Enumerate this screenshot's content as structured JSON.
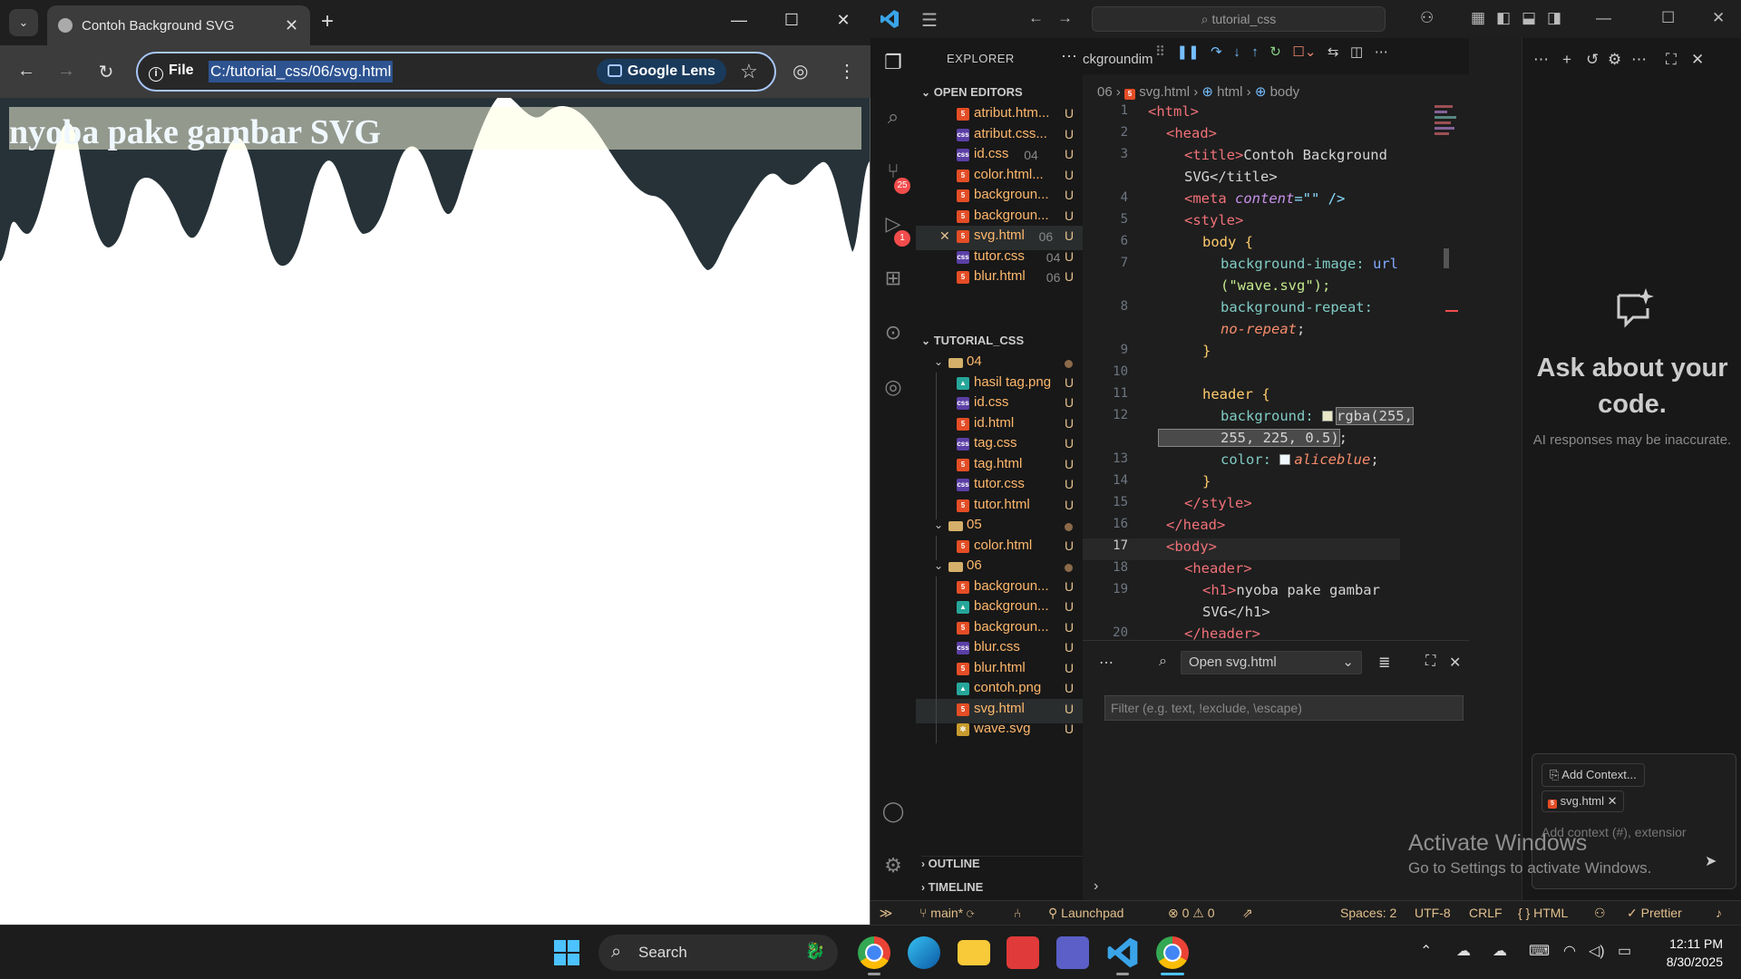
{
  "browser": {
    "tab_title": "Contoh Background SVG",
    "site_label": "File",
    "url": "C:/tutorial_css/06/svg.html",
    "lens_label": "Google Lens",
    "page_heading": "nyoba pake gambar SVG"
  },
  "vscode": {
    "command_center": "tutorial_css",
    "explorer_title": "EXPLORER",
    "open_editors_title": "OPEN EDITORS",
    "open_editors": [
      {
        "name": "atribut.htm...",
        "badge": "U",
        "type": "html",
        "num": ""
      },
      {
        "name": "atribut.css...",
        "badge": "U",
        "type": "css",
        "num": ""
      },
      {
        "name": "id.css",
        "badge": "U",
        "type": "css",
        "num": "04"
      },
      {
        "name": "color.html...",
        "badge": "U",
        "type": "html",
        "num": ""
      },
      {
        "name": "backgroun...",
        "badge": "U",
        "type": "html",
        "num": ""
      },
      {
        "name": "backgroun...",
        "badge": "U",
        "type": "html",
        "num": ""
      },
      {
        "name": "svg.html",
        "badge": "U",
        "type": "html",
        "num": "06"
      },
      {
        "name": "tutor.css",
        "badge": "U",
        "type": "css",
        "num": "04"
      },
      {
        "name": "blur.html",
        "badge": "U",
        "type": "html",
        "num": "06"
      }
    ],
    "workspace_title": "TUTORIAL_CSS",
    "tree": [
      {
        "name": "04",
        "type": "folder",
        "badge": ""
      },
      {
        "name": "hasil tag.png",
        "type": "img",
        "badge": "U"
      },
      {
        "name": "id.css",
        "type": "css",
        "badge": "U"
      },
      {
        "name": "id.html",
        "type": "html",
        "badge": "U"
      },
      {
        "name": "tag.css",
        "type": "css",
        "badge": "U"
      },
      {
        "name": "tag.html",
        "type": "html",
        "badge": "U"
      },
      {
        "name": "tutor.css",
        "type": "css",
        "badge": "U"
      },
      {
        "name": "tutor.html",
        "type": "html",
        "badge": "U"
      },
      {
        "name": "05",
        "type": "folder",
        "badge": ""
      },
      {
        "name": "color.html",
        "type": "html",
        "badge": "U"
      },
      {
        "name": "06",
        "type": "folder",
        "badge": ""
      },
      {
        "name": "backgroun...",
        "type": "html",
        "badge": "U"
      },
      {
        "name": "backgroun...",
        "type": "img",
        "badge": "U"
      },
      {
        "name": "backgroun...",
        "type": "html",
        "badge": "U"
      },
      {
        "name": "blur.css",
        "type": "css",
        "badge": "U"
      },
      {
        "name": "blur.html",
        "type": "html",
        "badge": "U"
      },
      {
        "name": "contoh.png",
        "type": "img",
        "badge": "U"
      },
      {
        "name": "svg.html",
        "type": "html",
        "badge": "U"
      },
      {
        "name": "wave.svg",
        "type": "svg",
        "badge": "U"
      }
    ],
    "outline_title": "OUTLINE",
    "timeline_title": "TIMELINE",
    "editor_tab": "ckgroundim",
    "breadcrumbs": {
      "folder": "06",
      "file": "svg.html",
      "el1": "html",
      "el2": "body"
    },
    "line_numbers": [
      "1",
      "2",
      "3",
      "",
      "4",
      "5",
      "6",
      "7",
      "",
      "8",
      "",
      "9",
      "10",
      "11",
      "12",
      "",
      "13",
      "14",
      "15",
      "16",
      "17",
      "18",
      "19",
      "",
      "20"
    ],
    "code": {
      "l1": "<html>",
      "l2": "<head>",
      "l3a": "<title>",
      "l3b": "Contoh Background",
      "l3c": "SVG</title>",
      "l4a": "<meta ",
      "l4b": "content",
      "l4c": "=\"\" />",
      "l5": "<style>",
      "l6": "body {",
      "l7a": "background-image: ",
      "l7b": "url",
      "l7c": "(\"wave.svg\");",
      "l8a": "background-repeat:",
      "l8b": "no-repeat",
      "l8c": ";",
      "l9": "}",
      "l11": "header {",
      "l12a": "background: ",
      "l12b": "rgba(255,",
      "l12c": "255, 225, 0.5)",
      "l12d": ";",
      "l13a": "color: ",
      "l13b": "aliceblue",
      "l13c": ";",
      "l14": "}",
      "l15": "</style>",
      "l16": "</head>",
      "l17": "<body>",
      "l18": "<header>",
      "l19a": "<h1>",
      "l19b": "nyoba pake gambar",
      "l19c": "SVG</h1>",
      "l20": "</header>"
    },
    "panel_select": "Open svg.html",
    "panel_filter_placeholder": "Filter (e.g. text, !exclude, \\escape)",
    "chat_title": "Ask about your code.",
    "chat_subtitle": "AI responses may be inaccurate.",
    "chat_add_context": "Add Context...",
    "chat_context_file": "svg.html",
    "chat_placeholder": "Add context (#), extensior",
    "activity_badges": {
      "scm": "25",
      "debug": "1"
    },
    "statusbar": {
      "branch": "main*",
      "launchpad": "Launchpad",
      "errors": "0",
      "warnings": "0",
      "spaces": "Spaces: 2",
      "encoding": "UTF-8",
      "eol": "CRLF",
      "language": "HTML",
      "formatter": "Prettier"
    }
  },
  "watermark": {
    "title": "Activate Windows",
    "subtitle": "Go to Settings to activate Windows."
  },
  "taskbar": {
    "search_label": "Search",
    "time": "12:11 PM",
    "date": "8/30/2025"
  },
  "colors": {
    "wave_fill": "#263238",
    "header_bg": "rgba(255,255,225,0.5)",
    "accent": "#4cc2ff"
  }
}
